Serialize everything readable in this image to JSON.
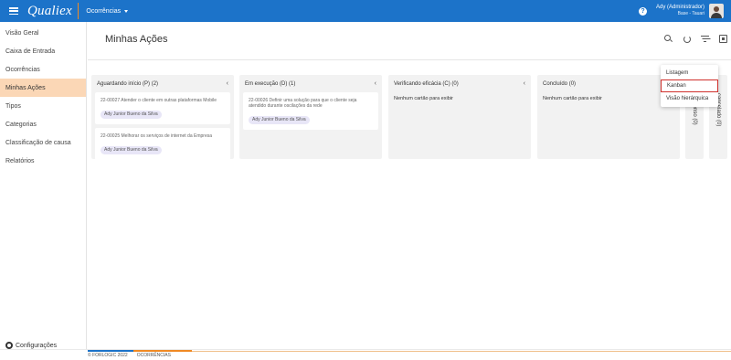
{
  "topbar": {
    "logo": "Qualiex",
    "module": "Ocorrências",
    "user_name": "Ady (Administrador)",
    "user_base": "Base - Tauari",
    "help": "?"
  },
  "sidebar": {
    "items": [
      {
        "label": "Visão Geral"
      },
      {
        "label": "Caixa de Entrada"
      },
      {
        "label": "Ocorrências"
      },
      {
        "label": "Minhas Ações"
      },
      {
        "label": "Tipos"
      },
      {
        "label": "Categorias"
      },
      {
        "label": "Classificação de causa"
      },
      {
        "label": "Relatórios"
      }
    ],
    "config_label": "Configurações"
  },
  "main": {
    "title": "Minhas Ações",
    "view_menu": {
      "items": [
        "Listagem",
        "Kanban",
        "Visão hierárquica"
      ]
    }
  },
  "board": {
    "columns": [
      {
        "title": "Aguardando início (P)",
        "count": "(2)",
        "cards": [
          {
            "title": "22-00027 Atender o cliente em outras plataformas Mobile",
            "assignee": "Ady Junior Bueno da Silva"
          },
          {
            "title": "22-00025 Melhorar os serviços de internet da Empresa",
            "assignee": "Ady Junior Bueno da Silva"
          }
        ]
      },
      {
        "title": "Em execução (D)",
        "count": "(1)",
        "cards": [
          {
            "title": "22-00026 Definir uma solução para que o cliente seja atendido durante oscilações da rede",
            "assignee": "Ady Junior Bueno da Silva"
          }
        ]
      },
      {
        "title": "Verificando eficácia (C)",
        "count": "(0)",
        "empty": "Nenhum cartão para exibir"
      },
      {
        "title": "Concluído",
        "count": "(0)",
        "empty": "Nenhum cartão para exibir"
      }
    ],
    "collapsed_columns": [
      "suspenso (0)",
      "cancelado (0)"
    ]
  },
  "footer": {
    "copyright": "© FORLOGIC 2022",
    "module": "OCORRÊNCIAS"
  }
}
